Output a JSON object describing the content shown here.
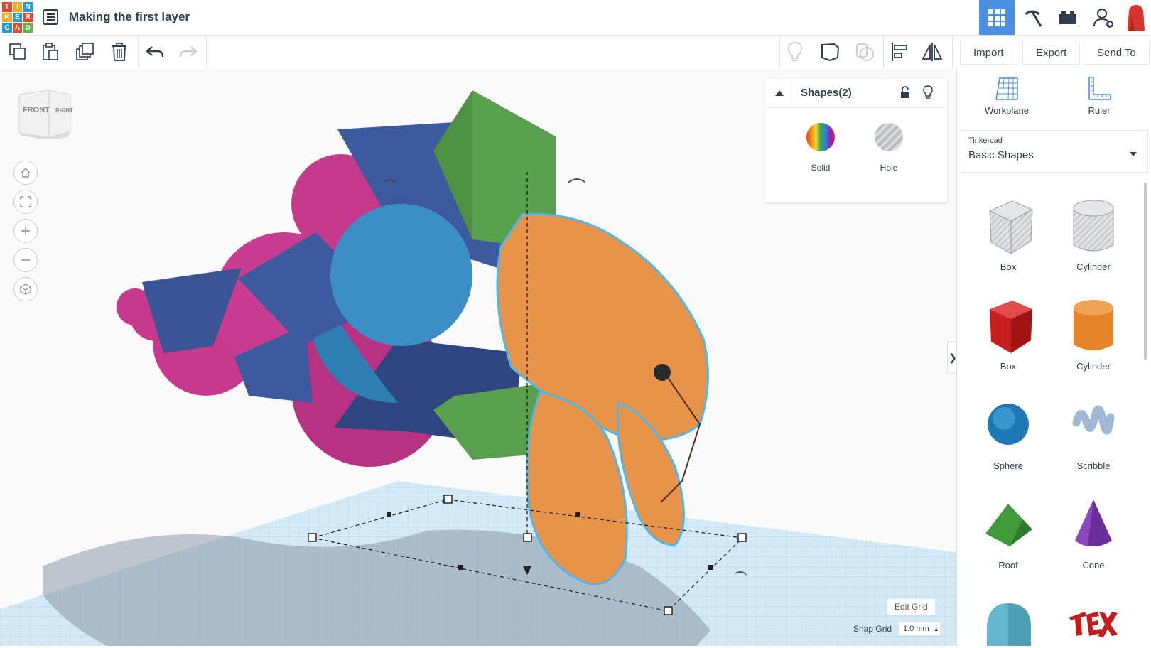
{
  "header": {
    "logo_letters": [
      "T",
      "I",
      "N",
      "K",
      "E",
      "R",
      "C",
      "A",
      "D"
    ],
    "title": "Making the first layer"
  },
  "toolbar": {
    "import_label": "Import",
    "export_label": "Export",
    "send_to_label": "Send To"
  },
  "viewcube": {
    "front": "FRONT",
    "right": "RIGHT"
  },
  "inspector": {
    "title": "Shapes(2)",
    "solid_label": "Solid",
    "hole_label": "Hole"
  },
  "sidebar": {
    "workplane_label": "Workplane",
    "ruler_label": "Ruler",
    "library_caption": "Tinkercad",
    "library_selected": "Basic Shapes",
    "shapes": [
      "Box",
      "Cylinder",
      "Box",
      "Cylinder",
      "Sphere",
      "Scribble",
      "Roof",
      "Cone",
      "",
      "Text"
    ]
  },
  "grid": {
    "edit_grid_label": "Edit Grid",
    "snap_grid_label": "Snap Grid",
    "snap_grid_value": "1.0 mm"
  },
  "colors": {
    "accent": "#4a90e2",
    "shrimp": "#e8934a",
    "blue": "#3d5a9e",
    "green": "#58a04d",
    "magenta": "#c63a8e",
    "sphere": "#3b8fc6"
  }
}
